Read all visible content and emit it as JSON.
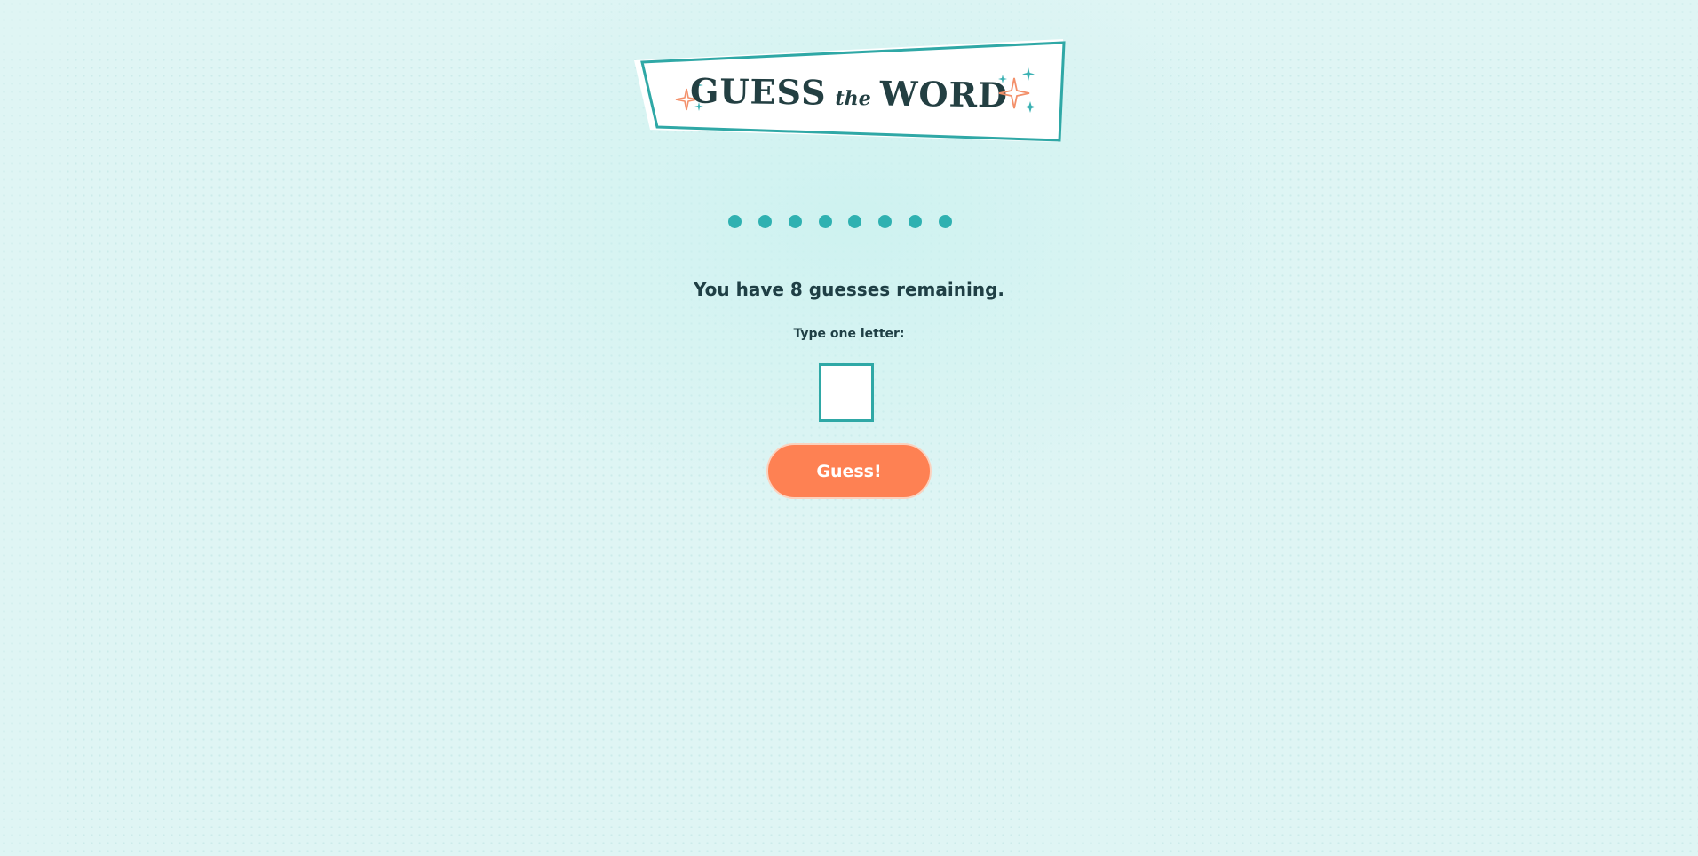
{
  "logo": {
    "word_left": "GUESS",
    "word_middle": "the",
    "word_right": "WORD"
  },
  "word_progress": {
    "hidden_letter_count": 8,
    "placeholder_symbol": "●"
  },
  "status": {
    "remaining_text": "You have 8 guesses remaining."
  },
  "guess_form": {
    "label": "Type one letter:",
    "input_value": "",
    "button_label": "Guess!"
  },
  "colors": {
    "background": "#dff5f4",
    "accent_teal": "#2fb1b1",
    "accent_orange": "#fe8153",
    "text_dark": "#1f3f45"
  }
}
